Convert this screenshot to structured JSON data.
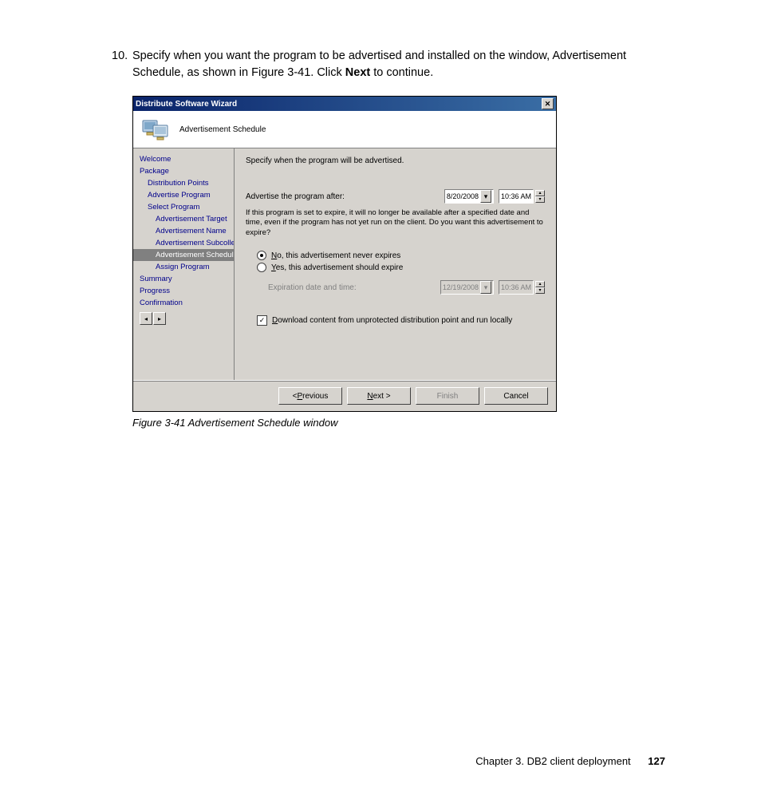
{
  "step": {
    "number": "10.",
    "text_before": "Specify when you want the program to be advertised and installed on the window, Advertisement Schedule, as shown in Figure 3-41. Click ",
    "bold": "Next",
    "text_after": " to continue."
  },
  "wizard": {
    "title": "Distribute Software Wizard",
    "header_label": "Advertisement Schedule",
    "sidebar": {
      "items": [
        {
          "label": "Welcome",
          "level": 0,
          "selected": false
        },
        {
          "label": "Package",
          "level": 0,
          "selected": false
        },
        {
          "label": "Distribution Points",
          "level": 1,
          "selected": false
        },
        {
          "label": "Advertise Program",
          "level": 1,
          "selected": false
        },
        {
          "label": "Select Program",
          "level": 1,
          "selected": false
        },
        {
          "label": "Advertisement Target",
          "level": 2,
          "selected": false
        },
        {
          "label": "Advertisement Name",
          "level": 2,
          "selected": false
        },
        {
          "label": "Advertisement Subcollec",
          "level": 2,
          "selected": false
        },
        {
          "label": "Advertisement Schedule",
          "level": 2,
          "selected": true
        },
        {
          "label": "Assign Program",
          "level": 2,
          "selected": false
        },
        {
          "label": "Summary",
          "level": 0,
          "selected": false
        },
        {
          "label": "Progress",
          "level": 0,
          "selected": false
        },
        {
          "label": "Confirmation",
          "level": 0,
          "selected": false
        }
      ]
    },
    "panel": {
      "description": "Specify when the program will be advertised.",
      "advertise_label": "Advertise the program after:",
      "advertise_date": "8/20/2008",
      "advertise_time": "10:36 AM",
      "expire_note": "If this program is set to expire, it will no longer be available after a specified date and time, even if the program has not yet run on the client. Do you want this advertisement to expire?",
      "radio_no_prefix": "N",
      "radio_no_rest": "o, this advertisement never expires",
      "radio_yes_prefix": "Y",
      "radio_yes_rest": "es, this advertisement should expire",
      "expiration_label": "Expiration date and time:",
      "expiration_date": "12/19/2008",
      "expiration_time": "10:36 AM",
      "download_prefix": "D",
      "download_rest": "ownload content from unprotected distribution point and run locally"
    },
    "buttons": {
      "previous_prefix": "< ",
      "previous_u": "P",
      "previous_rest": "revious",
      "next_u": "N",
      "next_rest": "ext >",
      "finish": "Finish",
      "cancel": "Cancel"
    }
  },
  "caption": "Figure 3-41   Advertisement Schedule window",
  "footer": {
    "chapter": "Chapter 3. DB2 client deployment",
    "page": "127"
  }
}
